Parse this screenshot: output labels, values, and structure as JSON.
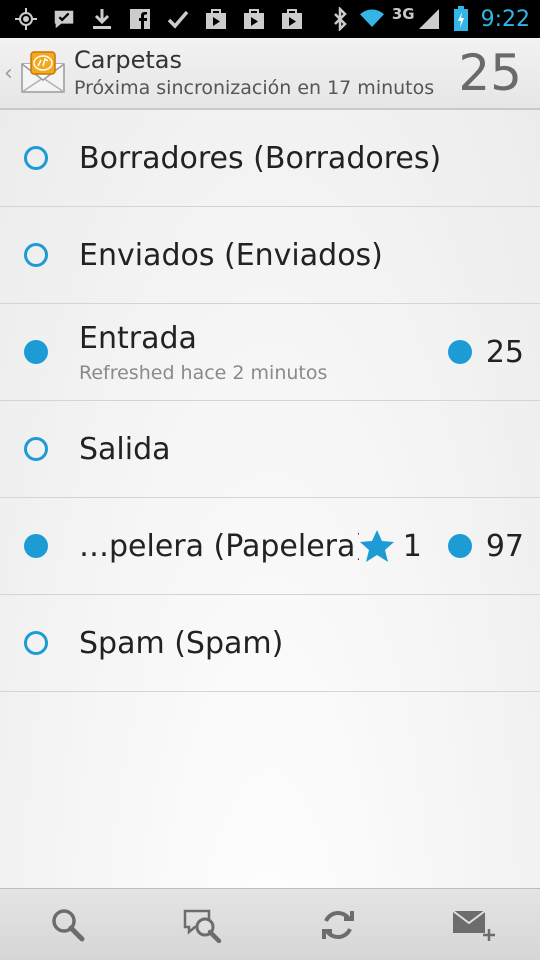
{
  "status_bar": {
    "network": "3G",
    "time": "9:22",
    "icons": [
      "gps-icon",
      "chat-bubble-icon",
      "download-icon",
      "facebook-icon",
      "check-icon",
      "play-store-icon",
      "play-store-icon",
      "play-store-icon",
      "bluetooth-icon",
      "wifi-icon",
      "signal-icon",
      "battery-charging-icon"
    ]
  },
  "action_bar": {
    "title": "Carpetas",
    "subtitle": "Próxima sincronización en 17 minutos",
    "count": "25",
    "logo": "k9-mail-envelope-icon",
    "up": "‹"
  },
  "folders": [
    {
      "name": "Borradores (Borradores)",
      "sub": "",
      "unread_dot": false
    },
    {
      "name": "Enviados (Enviados)",
      "sub": "",
      "unread_dot": false
    },
    {
      "name": "Entrada",
      "sub": "Refreshed hace 2 minutos",
      "unread_dot": true,
      "unread_count": "25"
    },
    {
      "name": "Salida",
      "sub": "",
      "unread_dot": false
    },
    {
      "name": "…pelera (Papelera)",
      "sub": "",
      "unread_dot": true,
      "starred_count": "1",
      "unread_count": "97"
    },
    {
      "name": "Spam (Spam)",
      "sub": "",
      "unread_dot": false
    }
  ],
  "bottom_bar": {
    "buttons": [
      "search-icon",
      "search-messages-icon",
      "refresh-icon",
      "compose-icon"
    ]
  },
  "colors": {
    "accent": "#1c9bd5",
    "status_accent": "#33b5e5"
  }
}
